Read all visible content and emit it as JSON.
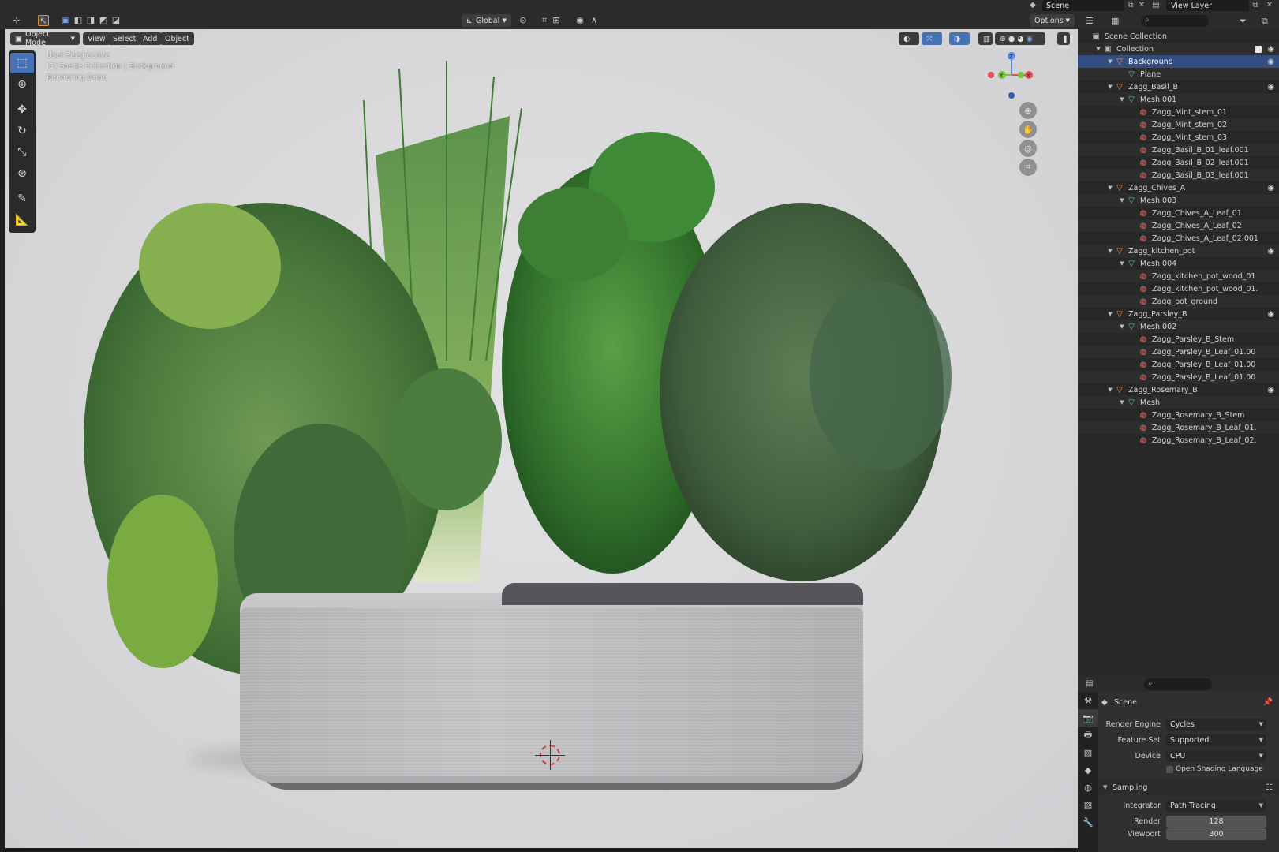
{
  "topbar": {
    "scene": "Scene",
    "view_layer": "View Layer"
  },
  "viewport_header": {
    "orientation": "Global",
    "options": "Options"
  },
  "menubar": {
    "mode": "Object Mode",
    "view": "View",
    "select": "Select",
    "add": "Add",
    "object": "Object"
  },
  "overlay": {
    "perspective": "User Perspective",
    "collection": "(1) Scene Collection | Background",
    "status": "Rendering Done"
  },
  "gizmo": {
    "z": "Z",
    "y": "Y",
    "x": "X"
  },
  "outliner": {
    "rows": [
      {
        "label": "Scene Collection",
        "indent": 0,
        "icon": "collection",
        "arrow": ""
      },
      {
        "label": "Collection",
        "indent": 1,
        "icon": "collection",
        "arrow": "▼"
      },
      {
        "label": "Background",
        "indent": 2,
        "icon": "object",
        "arrow": "▼"
      },
      {
        "label": "Plane",
        "indent": 3,
        "icon": "mesh",
        "arrow": ""
      },
      {
        "label": "Zagg_Basil_B",
        "indent": 2,
        "icon": "object",
        "arrow": "▼"
      },
      {
        "label": "Mesh.001",
        "indent": 3,
        "icon": "mesh",
        "arrow": "▼"
      },
      {
        "label": "Zagg_Mint_stem_01",
        "indent": 4,
        "icon": "material",
        "arrow": ""
      },
      {
        "label": "Zagg_Mint_stem_02",
        "indent": 4,
        "icon": "material",
        "arrow": ""
      },
      {
        "label": "Zagg_Mint_stem_03",
        "indent": 4,
        "icon": "material",
        "arrow": ""
      },
      {
        "label": "Zagg_Basil_B_01_leaf.001",
        "indent": 4,
        "icon": "material",
        "arrow": ""
      },
      {
        "label": "Zagg_Basil_B_02_leaf.001",
        "indent": 4,
        "icon": "material",
        "arrow": ""
      },
      {
        "label": "Zagg_Basil_B_03_leaf.001",
        "indent": 4,
        "icon": "material",
        "arrow": ""
      },
      {
        "label": "Zagg_Chives_A",
        "indent": 2,
        "icon": "object",
        "arrow": "▼"
      },
      {
        "label": "Mesh.003",
        "indent": 3,
        "icon": "mesh",
        "arrow": "▼"
      },
      {
        "label": "Zagg_Chives_A_Leaf_01",
        "indent": 4,
        "icon": "material",
        "arrow": ""
      },
      {
        "label": "Zagg_Chives_A_Leaf_02",
        "indent": 4,
        "icon": "material",
        "arrow": ""
      },
      {
        "label": "Zagg_Chives_A_Leaf_02.001",
        "indent": 4,
        "icon": "material",
        "arrow": ""
      },
      {
        "label": "Zagg_kitchen_pot",
        "indent": 2,
        "icon": "object",
        "arrow": "▼"
      },
      {
        "label": "Mesh.004",
        "indent": 3,
        "icon": "mesh",
        "arrow": "▼"
      },
      {
        "label": "Zagg_kitchen_pot_wood_01",
        "indent": 4,
        "icon": "material",
        "arrow": ""
      },
      {
        "label": "Zagg_kitchen_pot_wood_01.",
        "indent": 4,
        "icon": "material",
        "arrow": ""
      },
      {
        "label": "Zagg_pot_ground",
        "indent": 4,
        "icon": "material",
        "arrow": ""
      },
      {
        "label": "Zagg_Parsley_B",
        "indent": 2,
        "icon": "object",
        "arrow": "▼"
      },
      {
        "label": "Mesh.002",
        "indent": 3,
        "icon": "mesh",
        "arrow": "▼"
      },
      {
        "label": "Zagg_Parsley_B_Stem",
        "indent": 4,
        "icon": "material",
        "arrow": ""
      },
      {
        "label": "Zagg_Parsley_B_Leaf_01.00",
        "indent": 4,
        "icon": "material",
        "arrow": ""
      },
      {
        "label": "Zagg_Parsley_B_Leaf_01.00",
        "indent": 4,
        "icon": "material",
        "arrow": ""
      },
      {
        "label": "Zagg_Parsley_B_Leaf_01.00",
        "indent": 4,
        "icon": "material",
        "arrow": ""
      },
      {
        "label": "Zagg_Rosemary_B",
        "indent": 2,
        "icon": "object",
        "arrow": "▼"
      },
      {
        "label": "Mesh",
        "indent": 3,
        "icon": "mesh",
        "arrow": "▼"
      },
      {
        "label": "Zagg_Rosemary_B_Stem",
        "indent": 4,
        "icon": "material",
        "arrow": ""
      },
      {
        "label": "Zagg_Rosemary_B_Leaf_01.",
        "indent": 4,
        "icon": "material",
        "arrow": ""
      },
      {
        "label": "Zagg_Rosemary_B_Leaf_02.",
        "indent": 4,
        "icon": "material",
        "arrow": ""
      }
    ]
  },
  "properties": {
    "context": "Scene",
    "render_engine_label": "Render Engine",
    "render_engine": "Cycles",
    "feature_set_label": "Feature Set",
    "feature_set": "Supported",
    "device_label": "Device",
    "device": "CPU",
    "osl_label": "Open Shading Language",
    "sampling_label": "Sampling",
    "integrator_label": "Integrator",
    "integrator": "Path Tracing",
    "render_label": "Render",
    "render_samples": "128",
    "viewport_label": "Viewport",
    "viewport_samples": "300"
  },
  "colors": {
    "accent": "#4772b3",
    "selected_row": "#334d80",
    "object_icon": "#e89a3c",
    "mesh_icon": "#57c18a",
    "material_icon": "#e46b6b"
  }
}
